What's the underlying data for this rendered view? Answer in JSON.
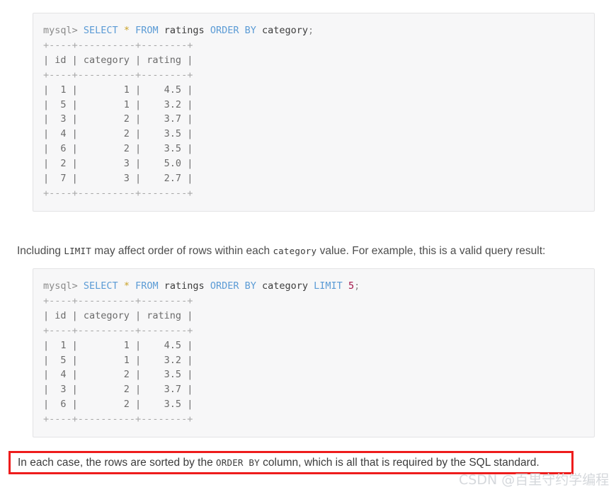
{
  "code_blocks": [
    {
      "id": "code-block-1",
      "prompt": "mysql>",
      "query": {
        "keywords_1": "SELECT",
        "star": "*",
        "keywords_2": "FROM",
        "table": "ratings",
        "keywords_3": "ORDER BY",
        "column": "category",
        "terminator": ";"
      },
      "query_text": "mysql> SELECT * FROM ratings ORDER BY category;",
      "rule": "+----+----------+--------+",
      "header": "| id | category | rating |",
      "rows": [
        "|  1 |        1 |    4.5 |",
        "|  5 |        1 |    3.2 |",
        "|  3 |        2 |    3.7 |",
        "|  4 |        2 |    3.5 |",
        "|  6 |        2 |    3.5 |",
        "|  2 |        3 |    5.0 |",
        "|  7 |        3 |    2.7 |"
      ],
      "table_data": {
        "columns": [
          "id",
          "category",
          "rating"
        ],
        "values": [
          [
            1,
            1,
            4.5
          ],
          [
            5,
            1,
            3.2
          ],
          [
            3,
            2,
            3.7
          ],
          [
            4,
            2,
            3.5
          ],
          [
            6,
            2,
            3.5
          ],
          [
            2,
            3,
            5.0
          ],
          [
            7,
            3,
            2.7
          ]
        ]
      }
    },
    {
      "id": "code-block-2",
      "prompt": "mysql>",
      "query": {
        "keywords_1": "SELECT",
        "star": "*",
        "keywords_2": "FROM",
        "table": "ratings",
        "keywords_3": "ORDER BY",
        "column": "category",
        "keywords_4": "LIMIT",
        "limit_value": "5",
        "terminator": ";"
      },
      "query_text": "mysql> SELECT * FROM ratings ORDER BY category LIMIT 5;",
      "rule": "+----+----------+--------+",
      "header": "| id | category | rating |",
      "rows": [
        "|  1 |        1 |    4.5 |",
        "|  5 |        1 |    3.2 |",
        "|  4 |        2 |    3.5 |",
        "|  3 |        2 |    3.7 |",
        "|  6 |        2 |    3.5 |"
      ],
      "table_data": {
        "columns": [
          "id",
          "category",
          "rating"
        ],
        "values": [
          [
            1,
            1,
            4.5
          ],
          [
            5,
            1,
            3.2
          ],
          [
            4,
            2,
            3.5
          ],
          [
            3,
            2,
            3.7
          ],
          [
            6,
            2,
            3.5
          ]
        ]
      }
    }
  ],
  "paragraph_middle": {
    "part_1": "Including ",
    "code_1": "LIMIT",
    "part_2": " may affect order of rows within each ",
    "code_2": "category",
    "part_3": " value. For example, this is a valid query result:"
  },
  "highlight": {
    "part_1": "In each case, the rows are sorted by the ",
    "code_1": "ORDER BY",
    "part_2": " column, which is all that is required by the SQL standard.",
    "border_color": "#ee1c1c"
  },
  "watermark": {
    "text": "CSDN @百里守约学编程",
    "color": "#d5d8dc"
  }
}
